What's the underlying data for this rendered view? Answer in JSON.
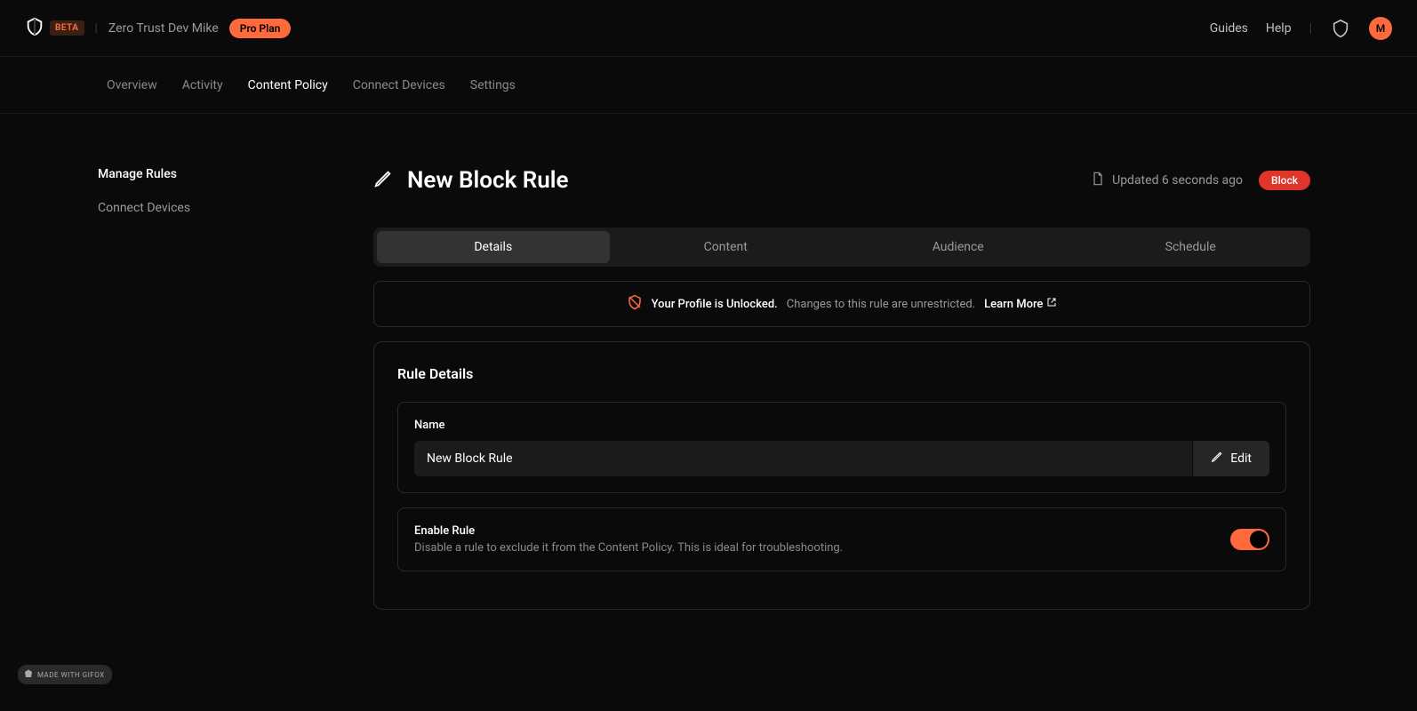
{
  "header": {
    "beta_label": "BETA",
    "workspace": "Zero Trust Dev Mike",
    "plan": "Pro Plan",
    "links": {
      "guides": "Guides",
      "help": "Help"
    },
    "avatar_initial": "M"
  },
  "subnav": {
    "items": [
      "Overview",
      "Activity",
      "Content Policy",
      "Connect Devices",
      "Settings"
    ],
    "active_index": 2
  },
  "sidebar": {
    "items": [
      "Manage Rules",
      "Connect Devices"
    ],
    "active_index": 0
  },
  "page": {
    "title": "New Block Rule",
    "updated": "Updated 6 seconds ago",
    "status_badge": "Block"
  },
  "tabs": {
    "items": [
      "Details",
      "Content",
      "Audience",
      "Schedule"
    ],
    "active_index": 0
  },
  "notice": {
    "title": "Your Profile is Unlocked.",
    "text": "Changes to this rule are unrestricted.",
    "link": "Learn More"
  },
  "panel": {
    "title": "Rule Details",
    "name_label": "Name",
    "name_value": "New Block Rule",
    "edit_label": "Edit",
    "enable_title": "Enable Rule",
    "enable_desc": "Disable a rule to exclude it from the Content Policy. This is ideal for troubleshooting.",
    "enable_on": true
  },
  "gifox": "MADE WITH GIFOX"
}
